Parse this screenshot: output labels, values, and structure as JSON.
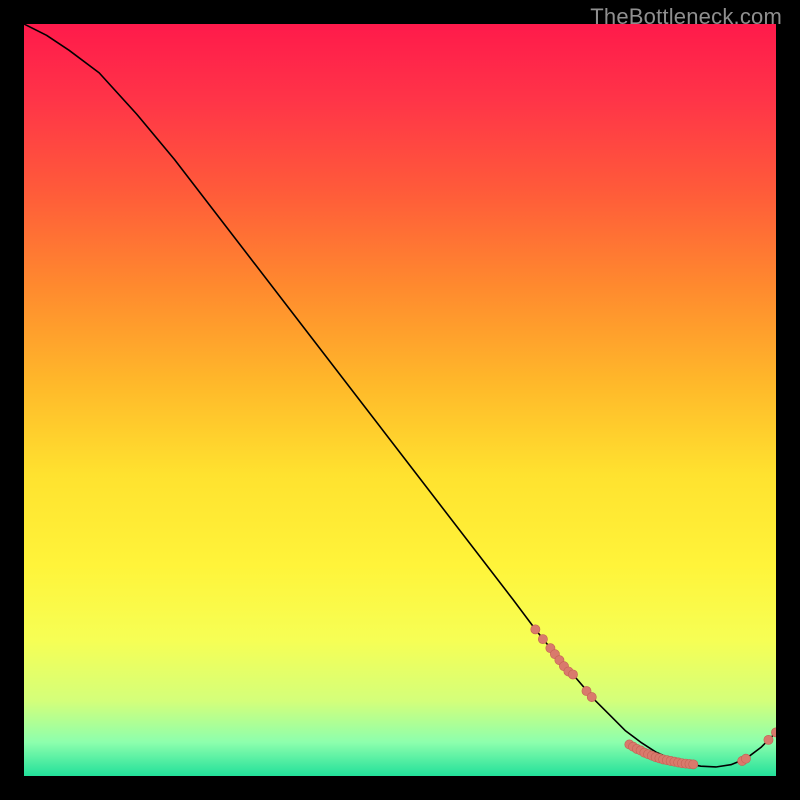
{
  "watermark": "TheBottleneck.com",
  "colors": {
    "marker_fill": "#d97a6c",
    "marker_stroke": "#c46054",
    "curve_stroke": "#000000"
  },
  "gradient_stops": [
    {
      "offset": 0.0,
      "color": "#ff1a4b"
    },
    {
      "offset": 0.1,
      "color": "#ff3448"
    },
    {
      "offset": 0.22,
      "color": "#ff5a3a"
    },
    {
      "offset": 0.35,
      "color": "#ff8a2e"
    },
    {
      "offset": 0.48,
      "color": "#ffb92a"
    },
    {
      "offset": 0.6,
      "color": "#ffe22f"
    },
    {
      "offset": 0.72,
      "color": "#fff43a"
    },
    {
      "offset": 0.82,
      "color": "#f6ff55"
    },
    {
      "offset": 0.9,
      "color": "#d4ff7a"
    },
    {
      "offset": 0.955,
      "color": "#8dffad"
    },
    {
      "offset": 1.0,
      "color": "#22e09a"
    }
  ],
  "chart_data": {
    "type": "line",
    "title": "",
    "xlabel": "",
    "ylabel": "",
    "xlim": [
      0,
      100
    ],
    "ylim": [
      0,
      100
    ],
    "series": [
      {
        "name": "curve",
        "x": [
          0,
          3,
          6,
          10,
          15,
          20,
          25,
          30,
          35,
          40,
          45,
          50,
          55,
          60,
          65,
          68,
          70,
          73,
          76,
          78,
          80,
          82,
          84,
          86,
          88,
          90,
          92,
          94,
          96,
          98,
          100
        ],
        "y": [
          100,
          98.5,
          96.5,
          93.5,
          88,
          82,
          75.5,
          69,
          62.5,
          56,
          49.5,
          43,
          36.5,
          30,
          23.5,
          19.5,
          17,
          13.5,
          10,
          8,
          6,
          4.5,
          3.2,
          2.3,
          1.7,
          1.3,
          1.2,
          1.5,
          2.3,
          3.8,
          5.8
        ]
      }
    ],
    "markers": [
      {
        "x": 68,
        "y": 19.5
      },
      {
        "x": 69,
        "y": 18.2
      },
      {
        "x": 70,
        "y": 17
      },
      {
        "x": 70.6,
        "y": 16.2
      },
      {
        "x": 71.2,
        "y": 15.4
      },
      {
        "x": 71.8,
        "y": 14.6
      },
      {
        "x": 72.4,
        "y": 13.9
      },
      {
        "x": 73,
        "y": 13.5
      },
      {
        "x": 74.8,
        "y": 11.3
      },
      {
        "x": 75.5,
        "y": 10.5
      },
      {
        "x": 80.5,
        "y": 4.2
      },
      {
        "x": 81,
        "y": 3.9
      },
      {
        "x": 81.5,
        "y": 3.6
      },
      {
        "x": 82,
        "y": 3.4
      },
      {
        "x": 82.5,
        "y": 3.1
      },
      {
        "x": 83,
        "y": 2.9
      },
      {
        "x": 83.5,
        "y": 2.7
      },
      {
        "x": 84,
        "y": 2.5
      },
      {
        "x": 84.5,
        "y": 2.35
      },
      {
        "x": 85,
        "y": 2.2
      },
      {
        "x": 85.5,
        "y": 2.1
      },
      {
        "x": 86,
        "y": 2.0
      },
      {
        "x": 86.5,
        "y": 1.9
      },
      {
        "x": 87,
        "y": 1.8
      },
      {
        "x": 87.5,
        "y": 1.7
      },
      {
        "x": 88,
        "y": 1.65
      },
      {
        "x": 88.5,
        "y": 1.6
      },
      {
        "x": 89,
        "y": 1.55
      },
      {
        "x": 95.5,
        "y": 2.0
      },
      {
        "x": 96,
        "y": 2.3
      },
      {
        "x": 99,
        "y": 4.8
      },
      {
        "x": 100,
        "y": 5.8
      }
    ]
  }
}
